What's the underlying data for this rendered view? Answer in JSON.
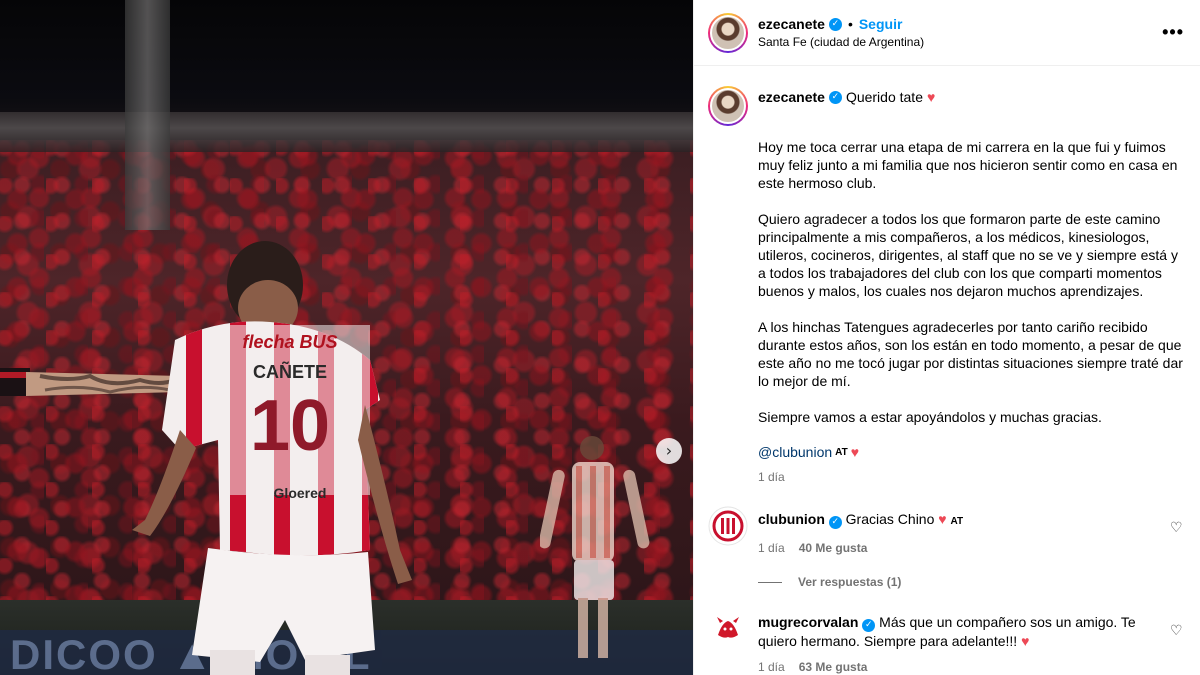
{
  "post": {
    "username": "ezecanete",
    "follow_label": "Seguir",
    "dot": "•",
    "location": "Santa Fe (ciudad de Argentina)",
    "more_label": "•••",
    "caption_intro": "Querido tate",
    "heart": "♥",
    "paragraphs": [
      "Hoy me toca cerrar una etapa de mi carrera en la que fui y fuimos muy feliz junto a mi familia que nos hicieron sentir como en casa en este hermoso club.",
      "Quiero agradecer a todos los que formaron parte de este camino principalmente a mis compañeros, a los médicos, kinesiologos, utileros, cocineros, dirigentes, al staff que no se ve y siempre está y a todos los trabajadores del club con los que comparti momentos buenos y malos, los cuales nos dejaron muchos aprendizajes.",
      "A los hinchas Tatengues agradecerles por tanto cariño recibido durante estos años, son los están en todo momento, a pesar de que este año no me tocó jugar por distintas situaciones siempre traté dar lo mejor de mí.",
      "Siempre vamos a estar apoyándolos y muchas gracias."
    ],
    "mention": "@clubunion",
    "at_tag": "AT",
    "time": "1 día"
  },
  "photo": {
    "jersey_sponsor": "flecha BUS",
    "jersey_name": "CAÑETE",
    "jersey_number": "10",
    "jersey_front": "Gloered",
    "banner_text": "DICOO ▲ MOVIL"
  },
  "comments": [
    {
      "username": "clubunion",
      "text": "Gracias Chino",
      "heart": "♥",
      "tag": "AT",
      "time": "1 día",
      "likes": "40 Me gusta",
      "replies": "Ver respuestas (1)"
    },
    {
      "username": "mugrecorvalan",
      "text": "Más que un compañero sos un amigo. Te quiero hermano. Siempre para adelante!!!",
      "heart": "♥",
      "time": "1 día",
      "likes": "63 Me gusta"
    }
  ],
  "icons": {
    "verified": "✓",
    "next": "›",
    "like": "♡"
  },
  "colors": {
    "accent": "#0095f6",
    "heart": "#ed4956",
    "muted": "#737373",
    "jersey_red": "#c8102e"
  }
}
